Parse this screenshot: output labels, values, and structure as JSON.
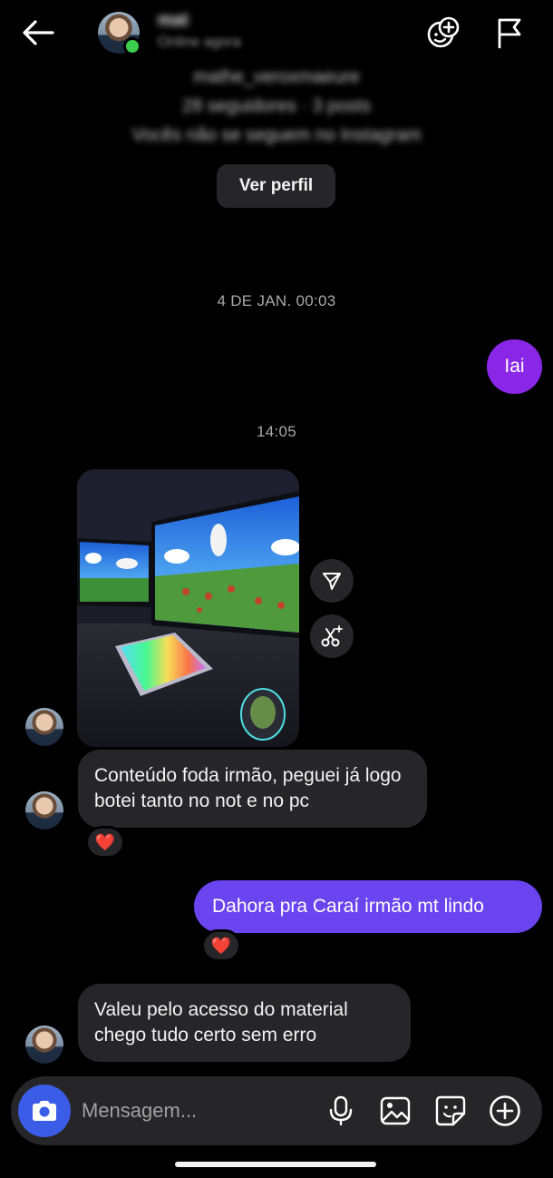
{
  "header": {
    "contact_name": "mat",
    "status": "Online agora",
    "back_icon": "arrow-left-icon",
    "effects_icon": "add-effect-icon",
    "report_icon": "flag-icon"
  },
  "profile": {
    "username": "mathe_veroxmaeure",
    "stats": "28 seguidores · 3 posts",
    "relation": "Vocês não se seguem no Instagram",
    "view_profile_label": "Ver perfil"
  },
  "conversation": {
    "timestamp_1": "4 DE JAN. 00:03",
    "msg_out_1": "Iai",
    "timestamp_2": "14:05",
    "photo_alt": "Foto de setup com monitores e teclado RGB",
    "msg_in_1": "Conteúdo foda irmão, peguei já logo botei tanto no not e no pc",
    "reaction_1": "❤️",
    "msg_out_2": "Dahora pra Caraí irmão mt lindo",
    "reaction_2": "❤️",
    "msg_in_2": "Valeu pelo acesso do material chego tudo certo sem erro"
  },
  "composer": {
    "placeholder": "Mensagem...",
    "camera_icon": "camera-icon",
    "mic_icon": "microphone-icon",
    "gallery_icon": "gallery-icon",
    "sticker_icon": "sticker-icon",
    "plus_icon": "plus-circle-icon"
  },
  "colors": {
    "background": "#000000",
    "bubble_in": "#262628",
    "bubble_out_purple": "#8a27e6",
    "bubble_out_indigo": "#6a44ef",
    "camera_button": "#3b5ce6",
    "online": "#3ccf4e",
    "heart": "#ff2f4f"
  }
}
